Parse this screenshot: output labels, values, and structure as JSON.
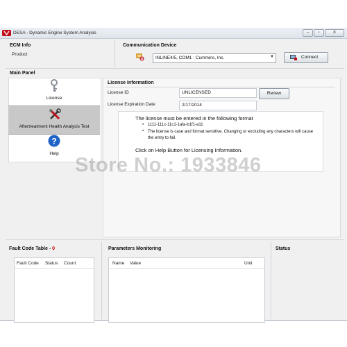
{
  "window": {
    "title": "DESA - Dynamic Engine System Analysis",
    "min_glyph": "–",
    "max_glyph": "▫",
    "close_glyph": "✕"
  },
  "ecm_info": {
    "heading": "ECM Info",
    "product_label": "Product"
  },
  "communication": {
    "heading": "Communication Device",
    "device_selected": "INLINE4/5, COM1 : Cummins, Inc.",
    "connect_label": "Connect"
  },
  "main_panel": {
    "heading": "Main Panel",
    "items": [
      {
        "label": "License",
        "icon": "key-icon"
      },
      {
        "label": "Aftertreatment Health Analysis Test",
        "icon": "tools-icon"
      },
      {
        "label": "Help",
        "icon": "help-icon"
      }
    ]
  },
  "license": {
    "heading": "License Information",
    "id_label": "License ID",
    "id_value": "UNLICENSED",
    "renew_label": "Renew",
    "expiration_label": "License Expiration Date",
    "expiration_value": "2/17/2014",
    "format_heading": "The license must be entered in the following format",
    "bullets": [
      "1111-111c-11c1-1afa-b1f1-a11",
      "The license is case and format sensitive. Changing or excluding any characters will cause the entry to fail."
    ],
    "help_note": "Click on Help Button for Licensing Information."
  },
  "fault_code_table": {
    "heading": "Fault Code Table - ",
    "count": "0",
    "columns": [
      "Fault Code",
      "Status",
      "Count"
    ]
  },
  "parameters_monitoring": {
    "heading": "Parameters Monitoring",
    "columns": [
      "Name",
      "Value",
      "Unit"
    ]
  },
  "status": {
    "heading": "Status"
  },
  "watermark": "Store No.: 1933846",
  "colors": {
    "fault_count": "#d00000",
    "help_blue": "#1f63c7",
    "accent_red": "#c0101b"
  }
}
